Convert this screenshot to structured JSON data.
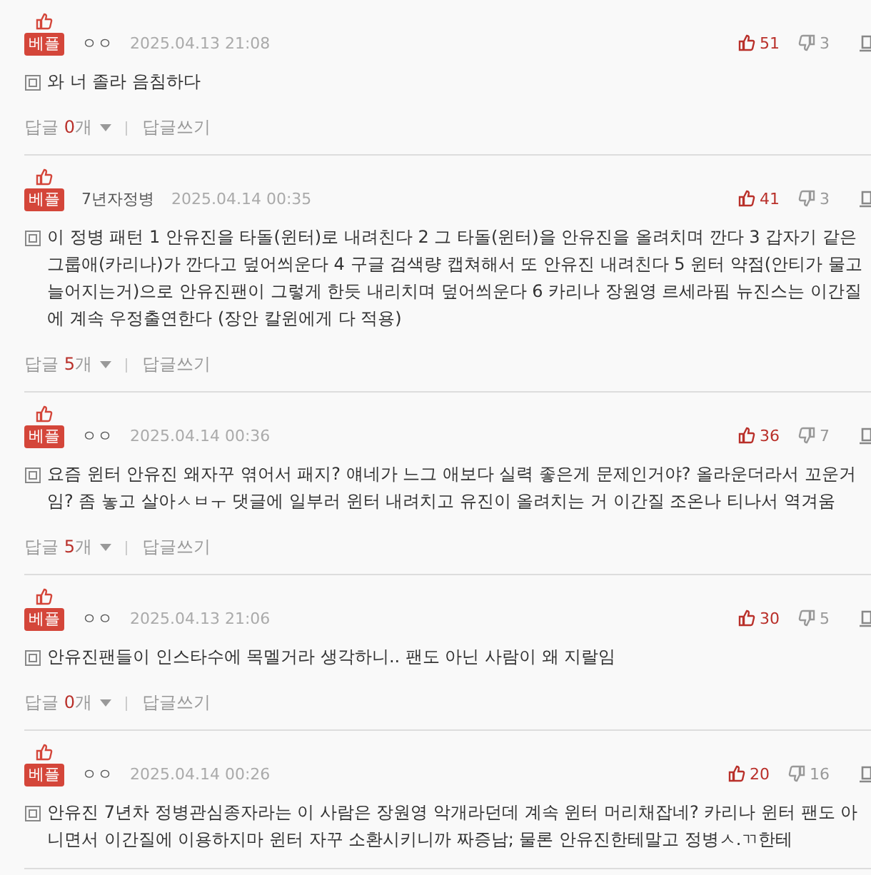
{
  "comments": [
    {
      "badge": "베플",
      "author": "ㅇㅇ",
      "date": "2025.04.13 21:08",
      "upvotes": "51",
      "downvotes": "3",
      "text": "와 너 졸라 음침하다",
      "replies": {
        "label": "답글",
        "count": "0",
        "unit": "개"
      },
      "reply_action": "답글쓰기"
    },
    {
      "badge": "베플",
      "author": "7년자정병",
      "date": "2025.04.14 00:35",
      "upvotes": "41",
      "downvotes": "3",
      "text": "이 정병 패턴 1 안유진을 타돌(윈터)로 내려친다 2 그 타돌(윈터)을 안유진을 올려치며 깐다 3 갑자기 같은 그룹애(카리나)가 깐다고 덮어씌운다 4 구글 검색량 캡쳐해서 또 안유진 내려친다 5 윈터 약점(안티가 물고늘어지는거)으로 안유진팬이 그렇게 한듯 내리치며 덮어씌운다 6 카리나 장원영 르세라핌 뉴진스는 이간질에 계속 우정출연한다 (장안 칼윈에게 다 적용)",
      "replies": {
        "label": "답글",
        "count": "5",
        "unit": "개"
      },
      "reply_action": "답글쓰기"
    },
    {
      "badge": "베플",
      "author": "ㅇㅇ",
      "date": "2025.04.14 00:36",
      "upvotes": "36",
      "downvotes": "7",
      "text": "요즘 윈터 안유진 왜자꾸 엮어서 패지? 얘네가 느그 애보다 실력 좋은게 문제인거야? 올라운더라서 꼬운거임? 좀 놓고 살아ㅅㅂㅜ 댓글에 일부러 윈터 내려치고 유진이 올려치는 거 이간질 조온나 티나서 역겨움",
      "replies": {
        "label": "답글",
        "count": "5",
        "unit": "개"
      },
      "reply_action": "답글쓰기"
    },
    {
      "badge": "베플",
      "author": "ㅇㅇ",
      "date": "2025.04.13 21:06",
      "upvotes": "30",
      "downvotes": "5",
      "text": "안유진팬들이 인스타수에 목멜거라 생각하니.. 팬도 아닌 사람이 왜 지랄임",
      "replies": {
        "label": "답글",
        "count": "0",
        "unit": "개"
      },
      "reply_action": "답글쓰기"
    },
    {
      "badge": "베플",
      "author": "ㅇㅇ",
      "date": "2025.04.14 00:26",
      "upvotes": "20",
      "downvotes": "16",
      "text": "안유진 7년차 정병관심종자라는 이 사람은 장원영 악개라던데 계속 윈터 머리채잡네? 카리나 윈터 팬도 아니면서 이간질에 이용하지마 윈터 자꾸 소환시키니까 짜증남; 물론 안유진한테말고 정병ㅅ.ㄲ한테"
    }
  ]
}
